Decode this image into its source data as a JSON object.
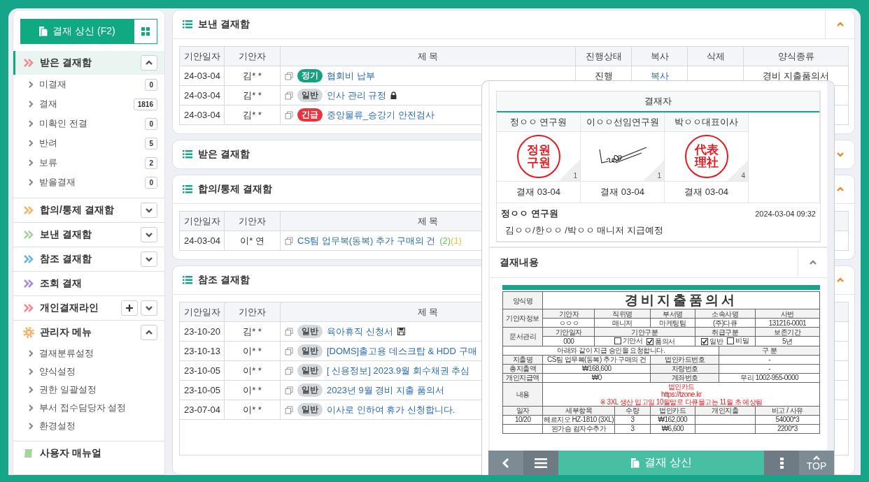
{
  "sidebar": {
    "compose_button": "결재 상신 (F2)",
    "groups": [
      {
        "label": "받은 결재함",
        "kind": "chevrons",
        "color": "#f28b8b",
        "selected": true,
        "expanded": true,
        "items": [
          {
            "label": "미결재",
            "count": "0"
          },
          {
            "label": "결재",
            "count": "1816"
          },
          {
            "label": "미확인 전결",
            "count": "0"
          },
          {
            "label": "반려",
            "count": "5"
          },
          {
            "label": "보류",
            "count": "2"
          },
          {
            "label": "받을결재",
            "count": "0"
          }
        ]
      },
      {
        "label": "합의/통제 결재함",
        "kind": "chevrons",
        "color": "#f5b36b",
        "selected": false,
        "expanded": false
      },
      {
        "label": "보낸 결재함",
        "kind": "chevrons",
        "color": "#9fd49a",
        "selected": false,
        "expanded": false
      },
      {
        "label": "참조 결재함",
        "kind": "chevrons",
        "color": "#6cb4e4",
        "selected": false,
        "expanded": false
      },
      {
        "label": "조회 결재",
        "kind": "chevrons",
        "color": "#a98bd8",
        "selected": false
      },
      {
        "label": "개인결재라인",
        "kind": "chevrons",
        "color": "#f28b8b",
        "selected": false,
        "expanded": false,
        "add": true
      },
      {
        "label": "관리자 메뉴",
        "kind": "gear",
        "color": "#f5b36b",
        "selected": false,
        "expanded": true,
        "items": [
          {
            "label": "결재분류설정"
          },
          {
            "label": "양식설정"
          },
          {
            "label": "권한 일괄설정"
          },
          {
            "label": "부서 접수담당자 설정"
          },
          {
            "label": "환경설정"
          }
        ]
      },
      {
        "label": "사용자 매뉴얼",
        "kind": "book",
        "color": "#a6d49a",
        "selected": false
      }
    ]
  },
  "panels": [
    {
      "title": "보낸 결재함",
      "expanded": true,
      "columns": [
        "기안일자",
        "기안자",
        "제 목",
        "진행상태",
        "복사",
        "삭제",
        "양식종류"
      ],
      "rows": [
        {
          "date": "24-03-04",
          "drafter": "김* *",
          "badge": {
            "text": "정기",
            "color": "#14a37f"
          },
          "subject": "협회비 납부",
          "status": "진행",
          "copy": "복사",
          "form": "경비 지출품의서"
        },
        {
          "date": "24-03-04",
          "drafter": "김* *",
          "badge": {
            "text": "일반",
            "color": "#d3d8dc"
          },
          "subject": "인사 관리 규정",
          "kind": "locked"
        },
        {
          "date": "24-03-04",
          "drafter": "김* *",
          "badge": {
            "text": "긴급",
            "color": "#e8343f"
          },
          "subject": "중앙물류_승강기 안전검사"
        }
      ]
    },
    {
      "title": "받은 결재함",
      "expanded": false
    },
    {
      "title": "합의/통제 결재함",
      "expanded": true,
      "columns": [
        "기안일자",
        "기안자",
        "제 목"
      ],
      "rows": [
        {
          "date": "24-03-04",
          "drafter": "이* 연",
          "subject": "CS팀 업무복(동복) 추가 구매의 건",
          "counts": [
            {
              "text": "(2)",
              "color": "#5cc85c"
            },
            {
              "text": "(1)",
              "color": "#f0c040"
            }
          ]
        }
      ]
    },
    {
      "title": "참조 결재함",
      "expanded": true,
      "columns": [
        "기안일자",
        "기안자",
        "제 목"
      ],
      "rows": [
        {
          "date": "23-10-20",
          "drafter": "김* *",
          "badge": {
            "text": "일반",
            "color": "#d3d8dc"
          },
          "subject": "육아휴직 신청서",
          "kind": "saved"
        },
        {
          "date": "23-10-13",
          "drafter": "이* *",
          "badge": {
            "text": "일반",
            "color": "#d3d8dc"
          },
          "subject": "[DOMS]출고용 데스크탑 & HDD 구매"
        },
        {
          "date": "23-10-05",
          "drafter": "이* *",
          "badge": {
            "text": "일반",
            "color": "#d3d8dc"
          },
          "subject": "[ 신용정보] 2023.9월 회수채권 추심"
        },
        {
          "date": "23-10-05",
          "drafter": "이* *",
          "badge": {
            "text": "일반",
            "color": "#d3d8dc"
          },
          "subject": "2023년 9월 경비 지출 품의서"
        },
        {
          "date": "23-07-04",
          "drafter": "이* *",
          "badge": {
            "text": "일반",
            "color": "#d3d8dc"
          },
          "subject": "이사로 인하여 휴가 신청합니다."
        }
      ]
    }
  ],
  "popup": {
    "approval": {
      "title": "결재자",
      "approvers": [
        {
          "name": "정ㅇㅇ 연구원",
          "kind": "seal",
          "seal_lines": [
            "정원",
            "구원"
          ],
          "count": "1",
          "result": "결재 03-04"
        },
        {
          "name": "이ㅇㅇ선임연구원",
          "kind": "signature",
          "count": "1",
          "result": "결재 03-04"
        },
        {
          "name": "박ㅇㅇ대표이사",
          "kind": "seal",
          "seal_lines": [
            "代表",
            "理社"
          ],
          "count": "4",
          "result": "결재 03-04"
        }
      ],
      "comment": {
        "author": "정ㅇㅇ 연구원",
        "time": "2024-03-04 09:32",
        "text": "김ㅇㅇ/한ㅇㅇ /박ㅇㅇ 매니저 지급예정"
      }
    },
    "content": {
      "title": "결재내용",
      "expanded": true,
      "document": {
        "form_label": "양식명",
        "title": "경비지출품의서",
        "drafter_label": "기안자정보",
        "drafter_headers": [
          "기안자",
          "직위명",
          "부서명",
          "소속사명",
          "사번"
        ],
        "drafter_values": [
          "ㅇㅇㅇ",
          "매니저",
          "마케팅팀",
          "(주)다큐",
          "131216-0001"
        ],
        "doc_label": "문서관리",
        "doc_headers": [
          "기안일자",
          "기안구분",
          "취급구분",
          "보존기간"
        ],
        "doc_date": "000",
        "draft_types": [
          {
            "label": "기안서",
            "checked": false
          },
          {
            "label": "품의서",
            "checked": true
          }
        ],
        "handling": [
          {
            "label": "일반",
            "checked": true
          },
          {
            "label": "비밀",
            "checked": false
          }
        ],
        "retention": "5년",
        "notice": "아래와 같이 지급 승인을 요청합니다.",
        "category": "구 분",
        "fields": [
          {
            "label": "지출명",
            "value": "CS팀 업무복(동복) 추가 구매의 건",
            "label2": "법인카드번호",
            "value2": "-"
          },
          {
            "label": "총지출액",
            "value": "₩168,600",
            "label2": "차량번호",
            "value2": "-"
          },
          {
            "label": "개인지급액",
            "value": "₩0",
            "label2": "계좌번호",
            "value2": "우리 1002-955-0000"
          }
        ],
        "memo_label": "내용",
        "memo_lines": [
          "법인카드",
          "https://tzone.kr",
          "※ 3XL 생산 입고일 10월말로 다큐물고는 11월 초 예상됨"
        ],
        "item_headers": [
          "일자",
          "세부항목",
          "수량",
          "법인카드",
          "개인지출",
          "비고 / 사유"
        ],
        "items": [
          {
            "date": "10/20",
            "detail": "헤르지오 HZ-1810 (3XL)",
            "qty": "3",
            "card": "₩162,000",
            "note": "54000*3"
          },
          {
            "detail": "왼가슴 컴자수추가",
            "qty": "3",
            "card": "₩6,600",
            "note": "2200*3"
          }
        ]
      }
    },
    "toolbar": {
      "submit": "결재 상신",
      "top": "TOP"
    }
  }
}
